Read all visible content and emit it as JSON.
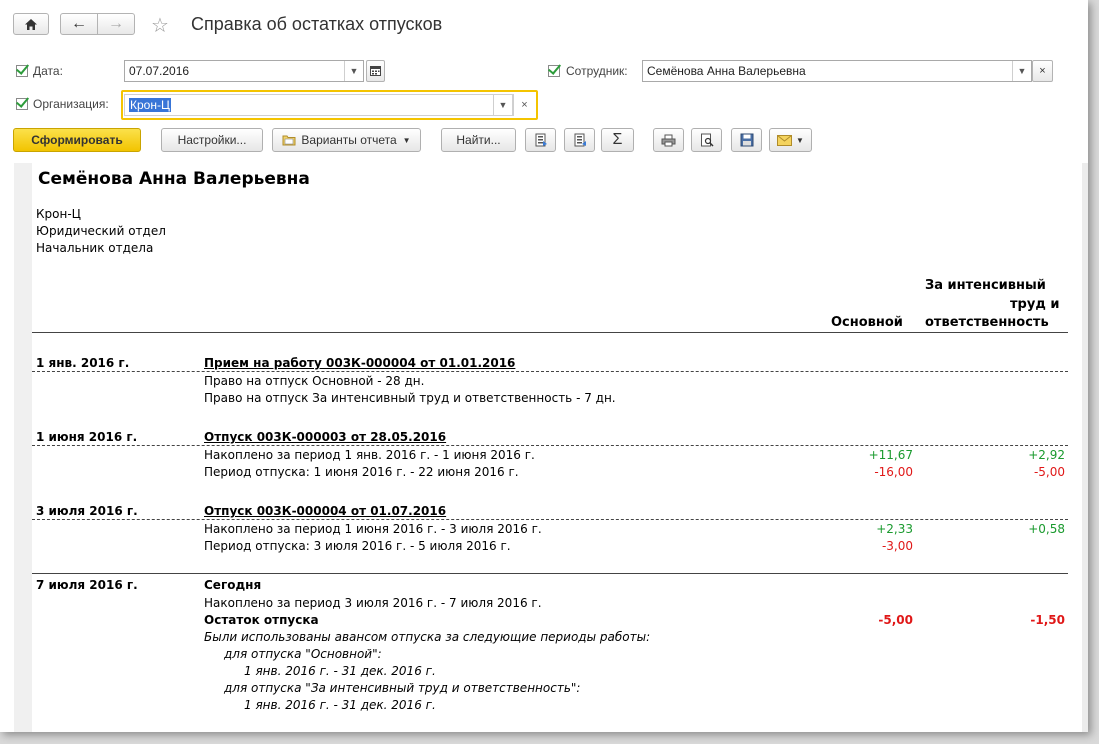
{
  "window": {
    "title": "Справка об остатках отпусков"
  },
  "filters": {
    "date_label": "Дата:",
    "date_value": "07.07.2016",
    "employee_label": "Сотрудник:",
    "employee_value": "Семёнова Анна Валерьевна",
    "org_label": "Организация:",
    "org_value": "Крон-Ц"
  },
  "toolbar": {
    "generate": "Сформировать",
    "settings": "Настройки...",
    "variants": "Варианты отчета",
    "find": "Найти...",
    "sum_icon": "Σ"
  },
  "report": {
    "name": "Семёнова Анна Валерьевна",
    "org": "Крон-Ц",
    "dept": "Юридический отдел",
    "position": "Начальник отдела",
    "col_main": "Основной",
    "col_extra_1": "За интенсивный",
    "col_extra_2": "труд и",
    "col_extra_3": "ответственность",
    "events": [
      {
        "date": "1 янв. 2016 г.",
        "title": "Прием на работу 003К-000004 от 01.01.2016",
        "lines": [
          "Право на отпуск Основной - 28 дн.",
          "Право на отпуск За интенсивный труд и ответственность - 7 дн."
        ]
      },
      {
        "date": "1 июня 2016 г.",
        "title": "Отпуск 003К-000003 от 28.05.2016",
        "lines": [
          "Накоплено за период 1 янв. 2016 г. - 1 июня 2016 г.",
          "Период отпуска: 1 июня 2016 г. - 22 июня 2016 г."
        ],
        "main": [
          "+11,67",
          "-16,00"
        ],
        "extra": [
          "+2,92",
          "-5,00"
        ]
      },
      {
        "date": "3 июля 2016 г.",
        "title": "Отпуск 003К-000004 от 01.07.2016",
        "lines": [
          "Накоплено за период 1 июня 2016 г. - 3 июля 2016 г.",
          "Период отпуска: 3 июля 2016 г. - 5 июля 2016 г."
        ],
        "main": [
          "+2,33",
          "-3,00"
        ],
        "extra": [
          "+0,58",
          ""
        ]
      },
      {
        "date": "7 июля 2016 г.",
        "title": "Сегодня",
        "lines": [
          "Накоплено за период 3 июля 2016 г. - 7 июля 2016 г.",
          "Остаток отпуска",
          "Были использованы авансом отпуска за следующие периоды работы:",
          "для отпуска \"Основной\":",
          "1 янв. 2016 г. - 31 дек. 2016 г.",
          "для отпуска \"За интенсивный труд и ответственность\":",
          "1 янв. 2016 г. - 31 дек. 2016 г."
        ],
        "main": [
          "-5,00"
        ],
        "extra": [
          "-1,50"
        ]
      }
    ]
  }
}
